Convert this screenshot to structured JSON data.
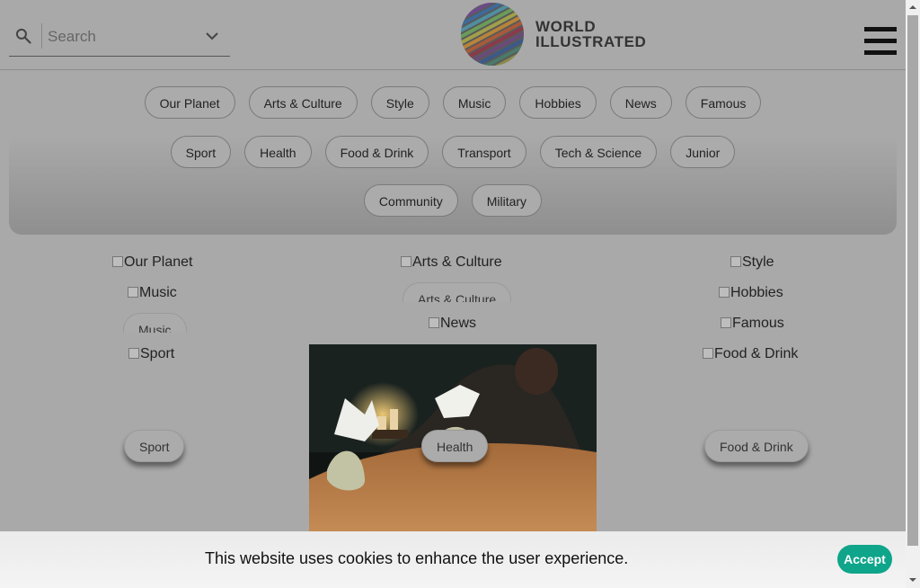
{
  "header": {
    "search_placeholder": "Search",
    "logo_line1": "WORLD",
    "logo_line2": "ILLUSTRATED"
  },
  "categories_row1": [
    "Our Planet",
    "Arts & Culture",
    "Style",
    "Music",
    "Hobbies",
    "News",
    "Famous"
  ],
  "categories_row2": [
    "Sport",
    "Health",
    "Food & Drink",
    "Transport",
    "Tech & Science",
    "Junior"
  ],
  "categories_row3": [
    "Community",
    "Military"
  ],
  "grid": {
    "img_our_planet": "Our Planet",
    "img_arts_culture": "Arts & Culture",
    "img_style": "Style",
    "img_music": "Music",
    "btn_arts_culture": "Arts & Culture",
    "img_hobbies": "Hobbies",
    "btn_music": "Music",
    "img_news": "News",
    "img_famous": "Famous",
    "img_sport": "Sport",
    "img_food_drink": "Food & Drink",
    "btn_sport": "Sport",
    "btn_health": "Health",
    "btn_food_drink": "Food & Drink"
  },
  "cookie": {
    "message": "This website uses cookies to enhance the user experience.",
    "accept_label": "Accept"
  },
  "colors": {
    "overlay_gray": "#a9a9a9",
    "accept_green": "#0fa58a"
  }
}
